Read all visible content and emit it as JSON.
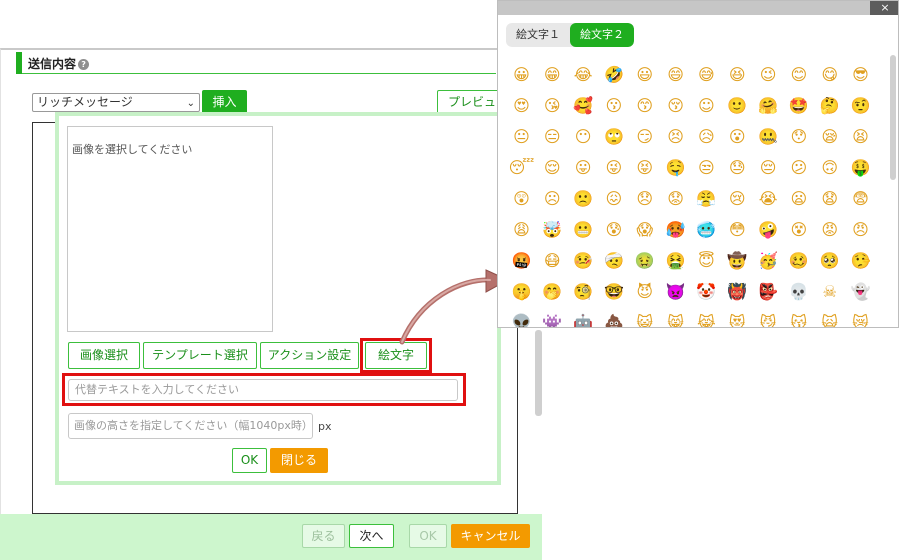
{
  "section": {
    "title": "送信内容",
    "help_icon": "?"
  },
  "toolbar": {
    "message_type": "リッチメッセージ",
    "insert_label": "挿入",
    "preview_label": "プレビュー"
  },
  "dialog": {
    "image_placeholder": "画像を選択してください",
    "buttons": {
      "select_image": "画像選択",
      "template_select": "テンプレート選択",
      "action_settings": "アクション設定",
      "emoji": "絵文字"
    },
    "alt_text_placeholder": "代替テキストを入力してください",
    "height_placeholder": "画像の高さを指定してください（幅1040px時）",
    "unit": "px",
    "ok": "OK",
    "close": "閉じる"
  },
  "footer": {
    "back": "戻る",
    "next": "次へ",
    "ok": "OK",
    "cancel": "キャンセル"
  },
  "picker": {
    "close_icon": "×",
    "tabs": [
      "絵文字１",
      "絵文字２"
    ],
    "active_tab": 1,
    "emoji_rows": [
      [
        "😀",
        "😁",
        "😂",
        "🤣",
        "😃",
        "😄",
        "😅",
        "😆",
        "😉",
        "😊",
        "😋",
        "😎"
      ],
      [
        "😍",
        "😘",
        "🥰",
        "😗",
        "😙",
        "😚",
        "☺",
        "🙂",
        "🤗",
        "🤩",
        "🤔",
        "🤨"
      ],
      [
        "😐",
        "😑",
        "😶",
        "🙄",
        "😏",
        "😣",
        "😥",
        "😮",
        "🤐",
        "😯",
        "😪",
        "😫"
      ],
      [
        "😴",
        "😌",
        "😛",
        "😜",
        "😝",
        "🤤",
        "😒",
        "😓",
        "😔",
        "😕",
        "🙃",
        "🤑"
      ],
      [
        "😲",
        "☹",
        "🙁",
        "😖",
        "😞",
        "😟",
        "😤",
        "😢",
        "😭",
        "😦",
        "😧",
        "😨"
      ],
      [
        "😩",
        "🤯",
        "😬",
        "😰",
        "😱",
        "🥵",
        "🥶",
        "😳",
        "🤪",
        "😵",
        "😡",
        "😠"
      ],
      [
        "🤬",
        "😷",
        "🤒",
        "🤕",
        "🤢",
        "🤮",
        "😇",
        "🤠",
        "🥳",
        "🥴",
        "🥺",
        "🤥"
      ],
      [
        "🤫",
        "🤭",
        "🧐",
        "🤓",
        "😈",
        "👿",
        "🤡",
        "👹",
        "👺",
        "💀",
        "☠",
        "👻"
      ],
      [
        "👽",
        "👾",
        "🤖",
        "💩",
        "😺",
        "😸",
        "😹",
        "😻",
        "😼",
        "😽",
        "🙀",
        "😿"
      ]
    ],
    "emoji_color": "#e0a020"
  },
  "colors": {
    "accent": "#1fae1f",
    "orange": "#f39a00",
    "highlight": "#e01010",
    "arrow": "#b5706b"
  }
}
